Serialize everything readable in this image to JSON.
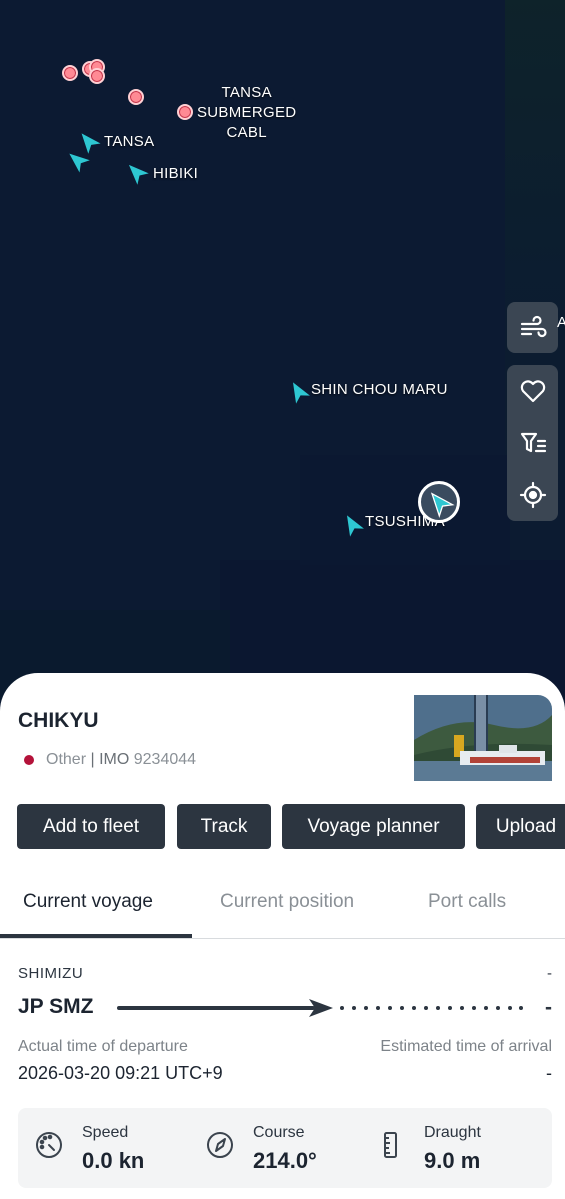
{
  "map": {
    "labels": {
      "tansa_cable": [
        "TANSA",
        "SUBMERGED",
        "CABL"
      ],
      "tansa": "TANSA",
      "hibiki": "HIBIKI",
      "shin_chou_maru": "SHIN CHOU MARU",
      "tsushima": "TSUSHIMA",
      "edge_letter": "A"
    },
    "controls": [
      "wind-icon",
      "heart-icon",
      "filter-list-icon",
      "locate-icon"
    ]
  },
  "vessel": {
    "name": "CHIKYU",
    "type": "Other",
    "imo_label": "IMO",
    "imo": "9234044",
    "separator": "|",
    "flag_color": "#b4123a"
  },
  "actions": [
    "Add to fleet",
    "Track",
    "Voyage planner",
    "Upload"
  ],
  "tabs": [
    "Current voyage",
    "Current position",
    "Port calls"
  ],
  "voyage": {
    "departure_port": "SHIMIZU",
    "departure_code": "JP SMZ",
    "arrival_port": "-",
    "arrival_code": "-",
    "atd_label": "Actual time of departure",
    "atd_value": "2026-03-20 09:21 UTC+9",
    "eta_label": "Estimated time of arrival",
    "eta_value": "-"
  },
  "stats": [
    {
      "label": "Speed",
      "value": "0.0 kn",
      "icon": "speedometer-icon"
    },
    {
      "label": "Course",
      "value": "214.0°",
      "icon": "compass-icon"
    },
    {
      "label": "Draught",
      "value": "9.0 m",
      "icon": "ruler-icon"
    }
  ],
  "colors": {
    "ship_marker": "#2ec7d2",
    "port_dot": "#ff8a94",
    "button_bg": "#2c3540",
    "map_bg": "#0c1a32"
  }
}
